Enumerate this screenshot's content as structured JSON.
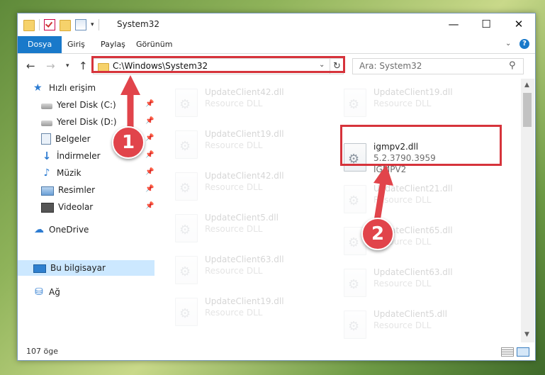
{
  "window": {
    "title": "System32",
    "min_glyph": "—",
    "max_glyph": "☐",
    "close_glyph": "✕"
  },
  "ribbon": {
    "tabs": [
      "Dosya",
      "Giriş",
      "Paylaş",
      "Görünüm"
    ],
    "help": "?"
  },
  "navigation": {
    "address": "C:\\Windows\\System32",
    "search_placeholder": "Ara: System32"
  },
  "sidebar": {
    "quick_access": "Hızlı erişim",
    "items": [
      {
        "label": "Yerel Disk (C:)",
        "icon": "drive-icon"
      },
      {
        "label": "Yerel Disk (D:)",
        "icon": "drive-icon"
      },
      {
        "label": "Belgeler",
        "icon": "documents-icon"
      },
      {
        "label": "İndirmeler",
        "icon": "downloads-icon"
      },
      {
        "label": "Müzik",
        "icon": "music-icon"
      },
      {
        "label": "Resimler",
        "icon": "pictures-icon"
      },
      {
        "label": "Videolar",
        "icon": "videos-icon"
      }
    ],
    "onedrive": "OneDrive",
    "this_pc": "Bu bilgisayar",
    "network": "Ağ"
  },
  "files": {
    "left_column": [
      {
        "name": "UpdateClient42.dll",
        "type": "Resource DLL"
      },
      {
        "name": "UpdateClient19.dll",
        "type": "Resource DLL"
      },
      {
        "name": "UpdateClient42.dll",
        "type": "Resource DLL"
      },
      {
        "name": "UpdateClient5.dll",
        "type": "Resource DLL"
      },
      {
        "name": "UpdateClient63.dll",
        "type": "Resource DLL"
      },
      {
        "name": "UpdateClient19.dll",
        "type": "Resource DLL"
      }
    ],
    "right_column": [
      {
        "name": "UpdateClient19.dll",
        "type": "Resource DLL"
      },
      {
        "name": "UpdateClient21.dll",
        "type": "Resource DLL"
      },
      {
        "name": "UpdateClient65.dll",
        "type": "Resource DLL"
      },
      {
        "name": "UpdateClient63.dll",
        "type": "Resource DLL"
      },
      {
        "name": "UpdateClient5.dll",
        "type": "Resource DLL"
      }
    ],
    "highlighted": {
      "name": "igmpv2.dll",
      "version": "5.2.3790.3959",
      "description": "IGMPV2"
    }
  },
  "status": {
    "item_count": "107 öge"
  },
  "annotations": {
    "badge_1": "1",
    "badge_2": "2",
    "color": "#d6333b"
  }
}
